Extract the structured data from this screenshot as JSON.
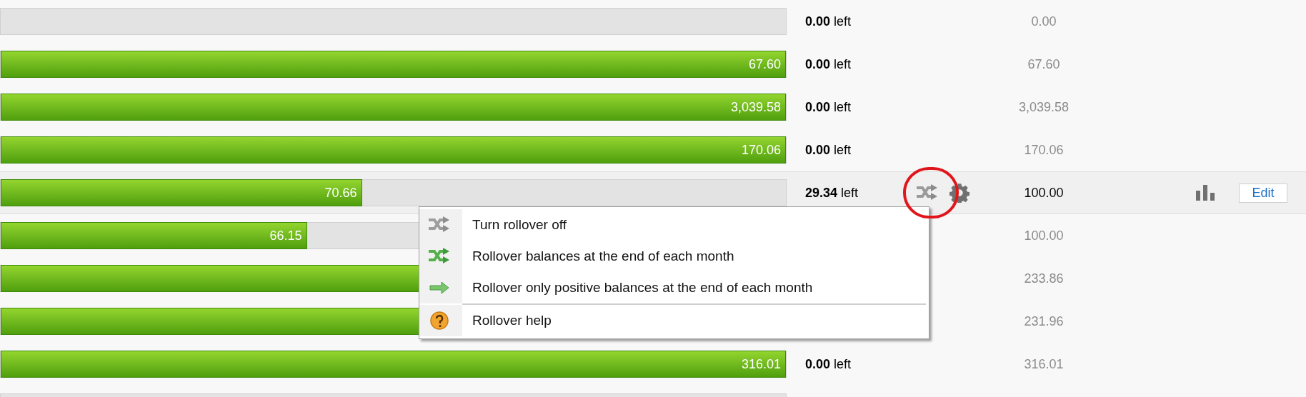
{
  "rows": [
    {
      "bar_label": "",
      "left": "**0.00** left",
      "budget": "0.00",
      "highlighted": false
    },
    {
      "level": 1,
      "bar_label": "67.60",
      "left": "**0.00** left",
      "budget": "67.60",
      "highlighted": false
    },
    {
      "level": 1,
      "bar_label": "3,039.58",
      "left": "**0.00** left",
      "budget": "3,039.58",
      "highlighted": false
    },
    {
      "level": 1,
      "bar_label": "170.06",
      "left": "**0.00** left",
      "budget": "170.06",
      "highlighted": false
    },
    {
      "level": 0.46,
      "bar_label": "70.66",
      "left": "**29.34** left",
      "budget": "100.00",
      "highlighted": true
    },
    {
      "level": 0.39,
      "bar_label": "66.15",
      "left": "",
      "budget": "100.00",
      "highlighted": false
    },
    {
      "level": 1,
      "bar_label": "",
      "left": "",
      "budget": "233.86",
      "highlighted": false
    },
    {
      "level": 1,
      "bar_label": "",
      "left": "",
      "budget": "231.96",
      "highlighted": false
    },
    {
      "level": 1,
      "bar_label": "316.01",
      "left": "**0.00** left",
      "budget": "316.01",
      "highlighted": false
    },
    {
      "bar_label": "",
      "left": "",
      "budget": "",
      "highlighted": false
    }
  ],
  "row_actions": {
    "edit_button": "Edit"
  },
  "rollover_menu": {
    "items": [
      {
        "kind": "off",
        "label": "Turn rollover off"
      },
      {
        "kind": "all",
        "label": "Rollover balances at the end of each month"
      },
      {
        "kind": "positive",
        "label": "Rollover only positive balances at the end of each month"
      },
      {
        "kind": "help",
        "label": "Rollover help"
      }
    ]
  }
}
